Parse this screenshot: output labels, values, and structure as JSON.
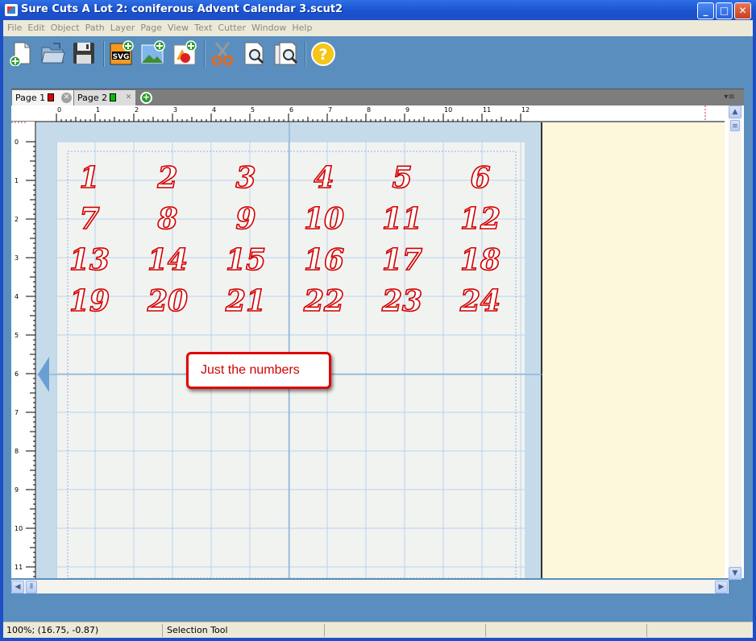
{
  "window": {
    "title": "Sure Cuts A Lot 2: coniferous Advent Calendar 3.scut2"
  },
  "menu": [
    "File",
    "Edit",
    "Object",
    "Path",
    "Layer",
    "Page",
    "View",
    "Text",
    "Cutter",
    "Window",
    "Help"
  ],
  "toolbar": {
    "icons": [
      "new-document-icon",
      "open-folder-icon",
      "save-disk-icon",
      "import-svg-icon",
      "import-image-icon",
      "add-shapes-icon",
      "cut-scissors-icon",
      "preview-icon",
      "cut-preview-icon",
      "help-icon"
    ],
    "svg_label": "SVG",
    "help_label": "?"
  },
  "tabs": [
    {
      "label": "Page 1",
      "color": "#e00000"
    },
    {
      "label": "Page 2",
      "color": "#00c000"
    }
  ],
  "ruler": {
    "top_labels": [
      "0",
      "1",
      "2",
      "3",
      "4",
      "5",
      "6",
      "7",
      "8",
      "9",
      "10",
      "11",
      "12"
    ],
    "left_labels": [
      "0",
      "1",
      "2",
      "3",
      "4",
      "5",
      "6",
      "7",
      "8",
      "9",
      "10",
      "11"
    ]
  },
  "mat_numbers": [
    "1",
    "2",
    "3",
    "4",
    "5",
    "6",
    "7",
    "8",
    "9",
    "10",
    "11",
    "12",
    "13",
    "14",
    "15",
    "16",
    "17",
    "18",
    "19",
    "20",
    "21",
    "22",
    "23",
    "24"
  ],
  "callout": {
    "text": "Just the numbers"
  },
  "status": {
    "zoom_coords": "100%; (16.75, -0.87)",
    "tool": "Selection Tool"
  },
  "colors": {
    "accent": "#d20000",
    "workspace": "#fdf7dc",
    "mat_frame": "#c5dbea",
    "title_bar": "#1d4fc6"
  }
}
